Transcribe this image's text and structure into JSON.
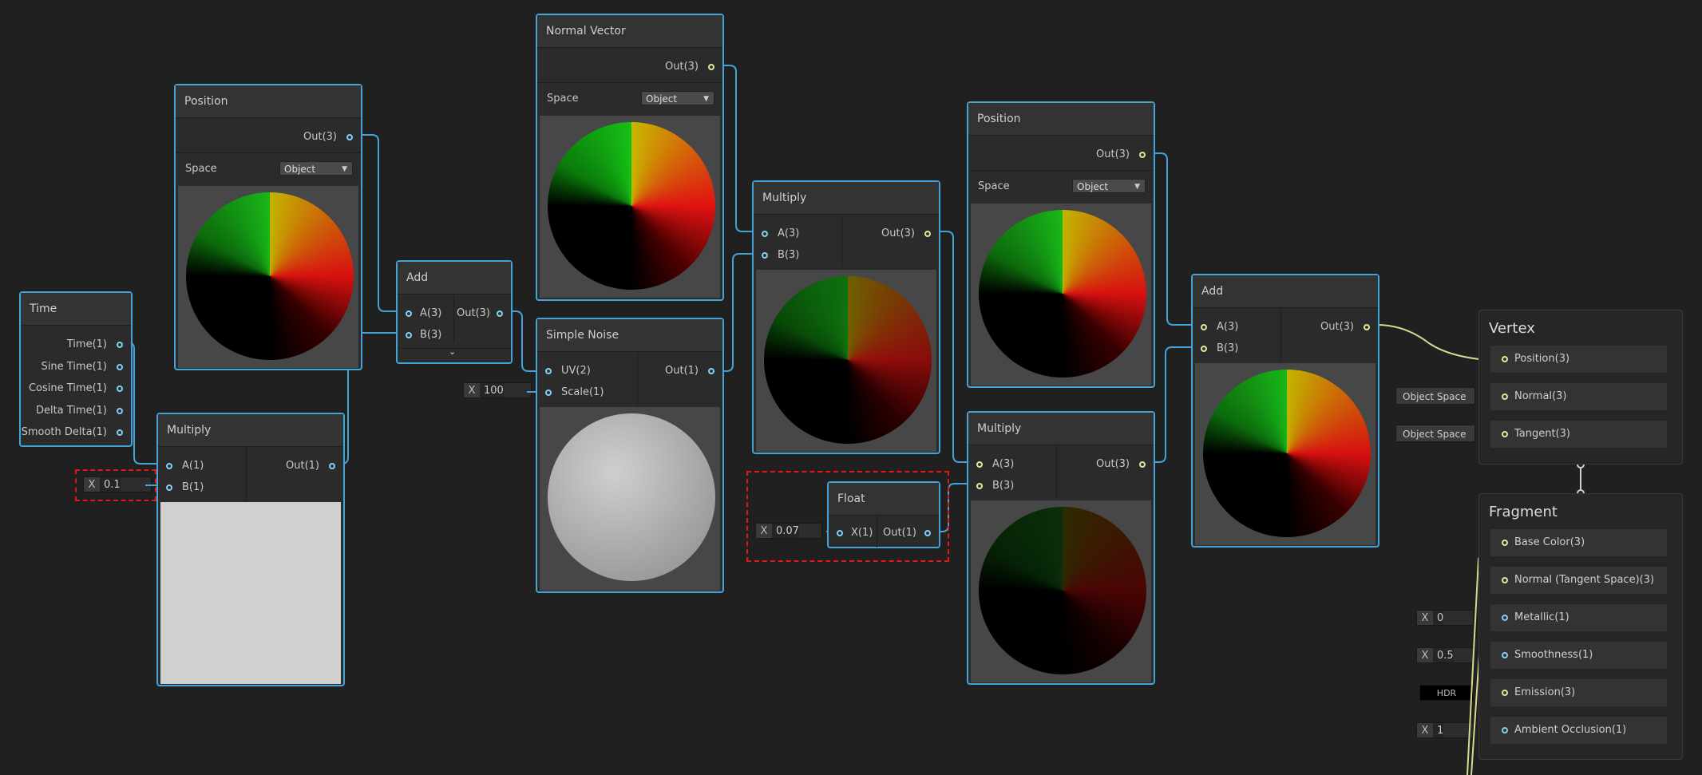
{
  "nodes": {
    "time": {
      "title": "Time",
      "outputs": [
        "Time(1)",
        "Sine Time(1)",
        "Cosine Time(1)",
        "Delta Time(1)",
        "Smooth Delta(1)"
      ]
    },
    "position1": {
      "title": "Position",
      "out": "Out(3)",
      "space_label": "Space",
      "space_value": "Object"
    },
    "multiply1": {
      "title": "Multiply",
      "in_a": "A(1)",
      "in_b": "B(1)",
      "out": "Out(1)",
      "b_x": "X",
      "b_value": "0.1"
    },
    "add1": {
      "title": "Add",
      "in_a": "A(3)",
      "in_b": "B(3)",
      "out": "Out(3)",
      "expand": "⌄"
    },
    "normal": {
      "title": "Normal Vector",
      "out": "Out(3)",
      "space_label": "Space",
      "space_value": "Object"
    },
    "noise": {
      "title": "Simple Noise",
      "in_uv": "UV(2)",
      "in_scale": "Scale(1)",
      "out": "Out(1)",
      "scale_x": "X",
      "scale_value": "100"
    },
    "multiply2": {
      "title": "Multiply",
      "in_a": "A(3)",
      "in_b": "B(3)",
      "out": "Out(3)"
    },
    "float": {
      "title": "Float",
      "in_x": "X(1)",
      "out": "Out(1)",
      "x_label": "X",
      "x_value": "0.07"
    },
    "position2": {
      "title": "Position",
      "out": "Out(3)",
      "space_label": "Space",
      "space_value": "Object"
    },
    "multiply3": {
      "title": "Multiply",
      "in_a": "A(3)",
      "in_b": "B(3)",
      "out": "Out(3)"
    },
    "add2": {
      "title": "Add",
      "in_a": "A(3)",
      "in_b": "B(3)",
      "out": "Out(3)"
    }
  },
  "vertex": {
    "title": "Vertex",
    "slots": [
      "Position(3)",
      "Normal(3)",
      "Tangent(3)"
    ],
    "normal_chip": "Object Space",
    "tangent_chip": "Object Space"
  },
  "fragment": {
    "title": "Fragment",
    "slots": [
      "Base Color(3)",
      "Normal (Tangent Space)(3)",
      "Metallic(1)",
      "Smoothness(1)",
      "Emission(3)",
      "Ambient Occlusion(1)"
    ],
    "metallic_x": "X",
    "metallic_value": "0",
    "smoothness_x": "X",
    "smoothness_value": "0.5",
    "emission_chip": "HDR",
    "ao_x": "X",
    "ao_value": "1"
  },
  "colors": {
    "wire": "#44a3d8",
    "wire_yellow": "#d7d98f",
    "accent_red": "#e01818",
    "background": "#202020"
  }
}
